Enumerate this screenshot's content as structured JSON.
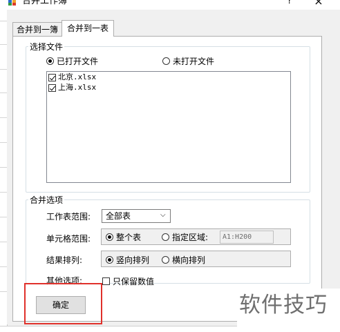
{
  "window": {
    "title": "合并工作簿",
    "help": "?",
    "close": "×"
  },
  "tabs": [
    {
      "label": "合并到一簿",
      "active": false
    },
    {
      "label": "合并到一表",
      "active": true
    }
  ],
  "select_files": {
    "group_title": "选择文件",
    "opened_label": "已打开文件",
    "opened_selected": true,
    "unopened_label": "未打开文件",
    "unopened_selected": false,
    "files": [
      {
        "name": "北京.xlsx",
        "checked": true
      },
      {
        "name": "上海.xlsx",
        "checked": true
      }
    ]
  },
  "merge_options": {
    "group_title": "合并选项",
    "scope_label": "工作表范围:",
    "scope_value": "全部表",
    "cell_range_label": "单元格范围:",
    "whole_table_label": "整个表",
    "whole_table_selected": true,
    "specify_area_label": "指定区域:",
    "specify_area_selected": false,
    "area_value": "A1:H200",
    "order_label": "结果排列:",
    "vertical_label": "竖向排列",
    "vertical_selected": true,
    "horizontal_label": "横向排列",
    "horizontal_selected": false,
    "other_label": "其他选项:",
    "keep_values_label": "只保留数值",
    "keep_values_checked": false
  },
  "ok_button": "确定",
  "watermark": "软件技巧",
  "colors": {
    "highlight": "#e0302a",
    "dialog_bg": "#f0f0f0"
  }
}
